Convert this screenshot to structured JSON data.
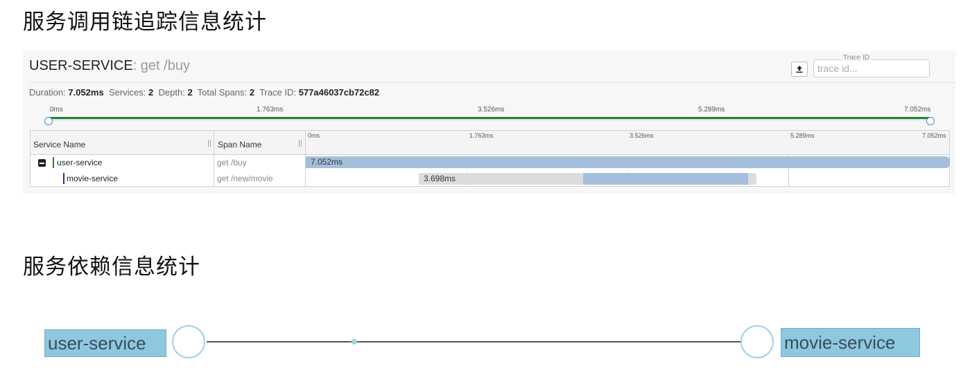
{
  "headings": {
    "trace_stats": "服务调用链追踪信息统计",
    "dependency_stats": "服务依赖信息统计"
  },
  "trace": {
    "service": "USER-SERVICE",
    "operation": ": get /buy",
    "export_icon": "upload-icon",
    "trace_id_legend": "Trace ID",
    "trace_id_placeholder": "trace id...",
    "summary": {
      "duration_label": "Duration:",
      "duration": "7.052ms",
      "services_label": "Services:",
      "services": "2",
      "depth_label": "Depth:",
      "depth": "2",
      "total_spans_label": "Total Spans:",
      "total_spans": "2",
      "trace_id_label": "Trace ID:",
      "trace_id": "577a46037cb72c82"
    },
    "timeline_ticks": [
      "0ms",
      "1.763ms",
      "3.526ms",
      "5.289ms",
      "7.052ms"
    ],
    "table": {
      "columns": {
        "service_name": "Service Name",
        "span_name": "Span Name"
      },
      "grip": "||",
      "rows": [
        {
          "service": "user-service",
          "span": "get /buy",
          "duration": "7.052ms",
          "color": "#2e7d32",
          "collapse_icon": "minus-square-icon",
          "start_fraction": 0.0,
          "end_fraction": 1.0
        },
        {
          "service": "movie-service",
          "span": "get /new/movie",
          "duration": "3.698ms",
          "color": "#283593",
          "start_fraction": 0.43,
          "end_fraction": 0.69
        }
      ]
    },
    "colors": {
      "bar_blue": "#a3bfdc",
      "bar_grey": "#dcdcdc",
      "minimap_green": "#2e7d32"
    }
  },
  "dependency": {
    "source": "user-service",
    "target": "movie-service"
  }
}
